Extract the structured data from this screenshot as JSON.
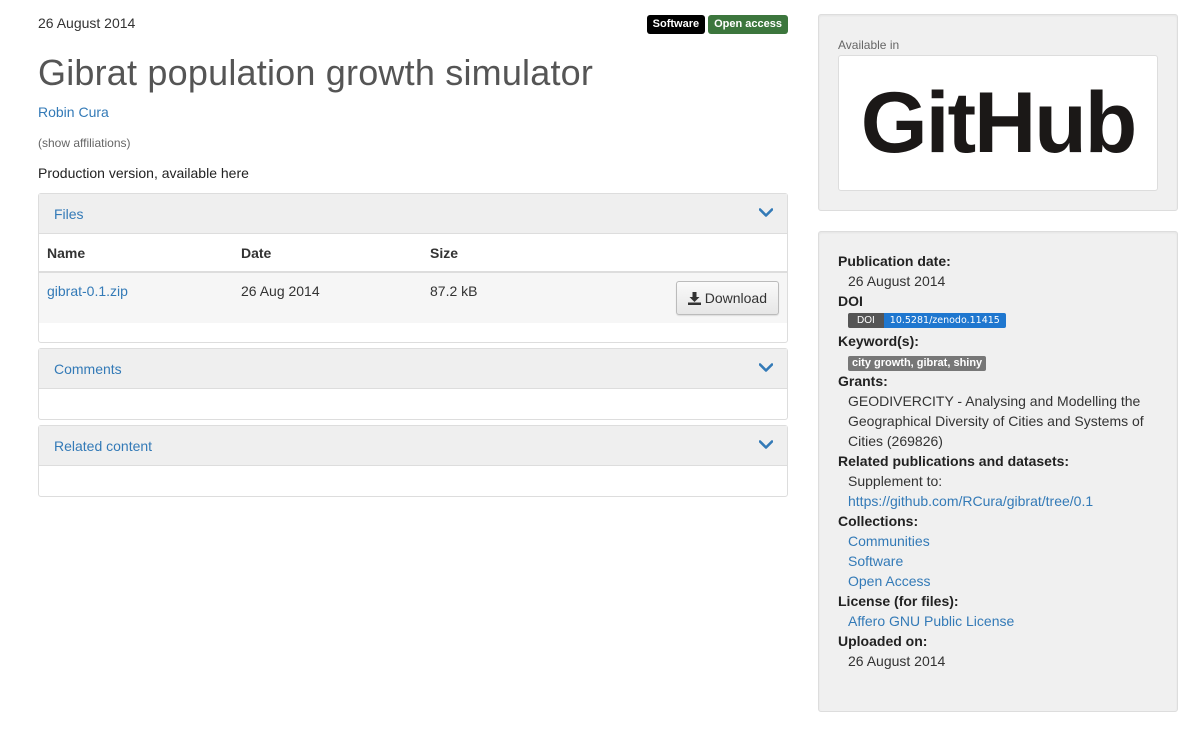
{
  "record": {
    "date": "26 August 2014",
    "badges": {
      "type": "Software",
      "access": "Open access"
    },
    "title": "Gibrat population growth simulator",
    "author": "Robin Cura",
    "show_affiliations": "(show affiliations)",
    "description": "Production version, available here"
  },
  "files_panel": {
    "title": "Files",
    "headers": {
      "name": "Name",
      "date": "Date",
      "size": "Size"
    },
    "file": {
      "name": "gibrat-0.1.zip",
      "date": "26 Aug 2014",
      "size": "87.2 kB",
      "download_label": "Download"
    }
  },
  "comments_panel": {
    "title": "Comments"
  },
  "related_panel": {
    "title": "Related content"
  },
  "sidebar": {
    "available_in": "Available in",
    "platform_logo": "GitHub",
    "meta": {
      "publication_date_label": "Publication date:",
      "publication_date": "26 August 2014",
      "doi_label": "DOI",
      "doi_prefix": "DOI",
      "doi_value": "10.5281/zenodo.11415",
      "keywords_label": "Keyword(s):",
      "keywords": "city growth, gibrat, shiny",
      "grants_label": "Grants:",
      "grant": "GEODIVERCITY - Analysing and Modelling the Geographical Diversity of Cities and Systems of Cities (269826)",
      "related_label": "Related publications and datasets:",
      "related_type": "Supplement to:",
      "related_link": "https://github.com/RCura/gibrat/tree/0.1",
      "collections_label": "Collections:",
      "collections": [
        "Communities",
        "Software",
        "Open Access"
      ],
      "license_label": "License (for files):",
      "license": "Affero GNU Public License",
      "uploaded_label": "Uploaded on:",
      "uploaded": "26 August 2014"
    }
  },
  "colors": {
    "link": "#337ab7",
    "open_access": "#3c763d",
    "doi_blue": "#1f77cf"
  }
}
